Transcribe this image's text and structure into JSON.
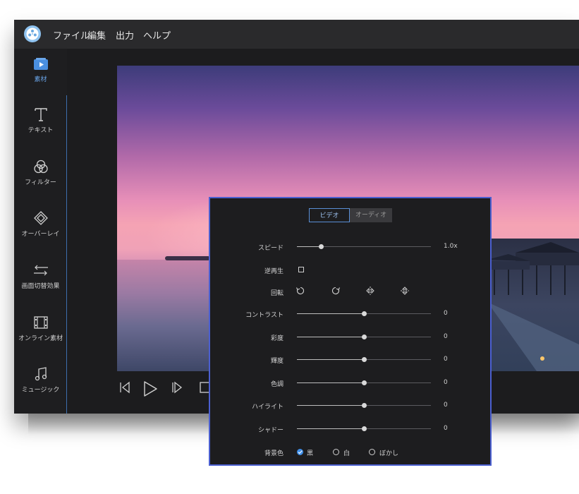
{
  "menubar": {
    "items": [
      "ファイル",
      "編集",
      "出力",
      "ヘルプ"
    ]
  },
  "sidebar": {
    "items": [
      {
        "label": "素材",
        "icon": "media-icon"
      },
      {
        "label": "テキスト",
        "icon": "text-icon"
      },
      {
        "label": "フィルター",
        "icon": "filter-icon"
      },
      {
        "label": "オーバーレイ",
        "icon": "overlay-icon"
      },
      {
        "label": "画面切替効果",
        "icon": "transition-icon"
      },
      {
        "label": "オンライン素材",
        "icon": "film-icon"
      },
      {
        "label": "ミュージック",
        "icon": "music-icon"
      }
    ]
  },
  "colors": {
    "accent": "#3f8ee8",
    "dialog_border": "#4b5fd0"
  },
  "dialog": {
    "tabs": [
      "ビデオ",
      "オーディオ"
    ],
    "active_tab": "ビデオ",
    "speed": {
      "label": "スピード",
      "value_text": "1.0x",
      "fraction": 0.18
    },
    "reverse": {
      "label": "逆再生",
      "checked": false
    },
    "rotate": {
      "label": "回転"
    },
    "sliders": [
      {
        "label": "コントラスト",
        "value": "0",
        "fraction": 0.5
      },
      {
        "label": "彩度",
        "value": "0",
        "fraction": 0.5
      },
      {
        "label": "輝度",
        "value": "0",
        "fraction": 0.5
      },
      {
        "label": "色調",
        "value": "0",
        "fraction": 0.5
      },
      {
        "label": "ハイライト",
        "value": "0",
        "fraction": 0.5
      },
      {
        "label": "シャドー",
        "value": "0",
        "fraction": 0.5
      }
    ],
    "background": {
      "label": "背景色",
      "options": [
        "黒",
        "白",
        "ぼかし"
      ],
      "selected": "黒"
    }
  }
}
